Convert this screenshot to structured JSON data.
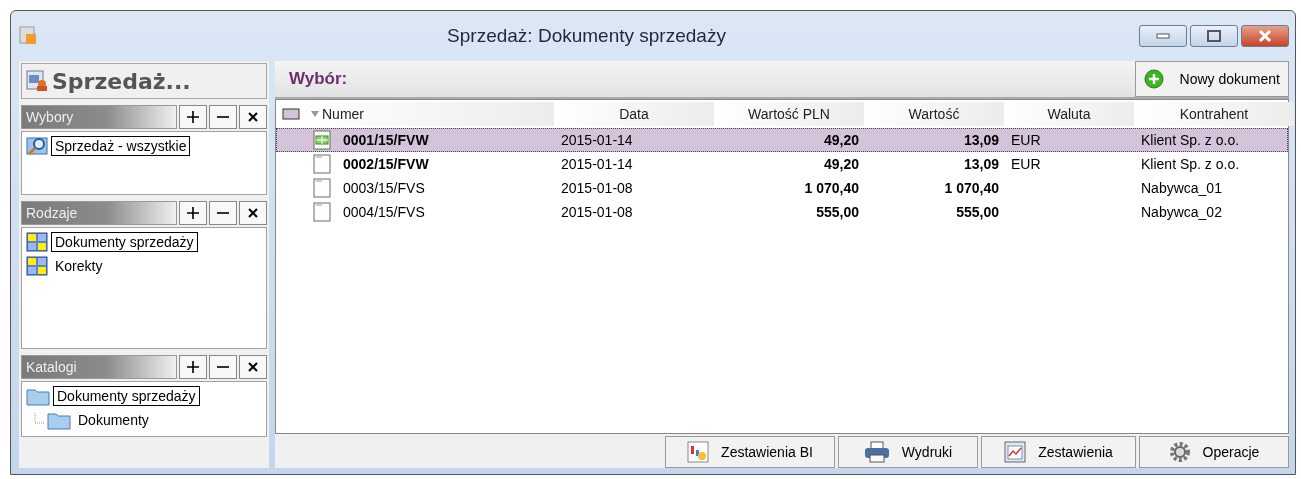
{
  "window": {
    "title": "Sprzedaż: Dokumenty sprzedaży"
  },
  "sidebar": {
    "title": "Sprzedaż...",
    "sections": [
      {
        "title": "Wybory",
        "items": [
          {
            "label": "Sprzedaż - wszystkie",
            "kind": "search",
            "selected": true
          }
        ]
      },
      {
        "title": "Rodzaje",
        "items": [
          {
            "label": "Dokumenty sprzedaży",
            "kind": "grid",
            "selected": true
          },
          {
            "label": "Korekty",
            "kind": "grid",
            "selected": false
          }
        ]
      },
      {
        "title": "Katalogi",
        "items": [
          {
            "label": "Dokumenty sprzedaży",
            "kind": "folder",
            "selected": true,
            "children": [
              {
                "label": "Dokumenty",
                "kind": "folder",
                "selected": false
              }
            ]
          }
        ]
      }
    ]
  },
  "selection_label": "Wybór:",
  "new_button": "Nowy dokument",
  "table": {
    "columns": [
      "Numer",
      "Data",
      "Wartość PLN",
      "Wartość",
      "Waluta",
      "Kontrahent"
    ],
    "rows": [
      {
        "selected": true,
        "bold": true,
        "kind": "invoice",
        "cells": [
          "0001/15/FVW",
          "2015-01-14",
          "49,20",
          "13,09",
          "EUR",
          "Klient Sp. z o.o."
        ]
      },
      {
        "selected": false,
        "bold": true,
        "kind": "blank",
        "cells": [
          "0002/15/FVW",
          "2015-01-14",
          "49,20",
          "13,09",
          "EUR",
          "Klient Sp. z o.o."
        ]
      },
      {
        "selected": false,
        "bold": false,
        "kind": "blank",
        "cells": [
          "0003/15/FVS",
          "2015-01-08",
          "1 070,40",
          "1 070,40",
          "",
          "Nabywca_01"
        ]
      },
      {
        "selected": false,
        "bold": false,
        "kind": "blank",
        "cells": [
          "0004/15/FVS",
          "2015-01-08",
          "555,00",
          "555,00",
          "",
          "Nabywca_02"
        ]
      }
    ]
  },
  "bottom_buttons": [
    {
      "label": "Zestawienia BI",
      "kind": "bi"
    },
    {
      "label": "Wydruki",
      "kind": "print"
    },
    {
      "label": "Zestawienia",
      "kind": "chart"
    },
    {
      "label": "Operacje",
      "kind": "gear"
    }
  ]
}
